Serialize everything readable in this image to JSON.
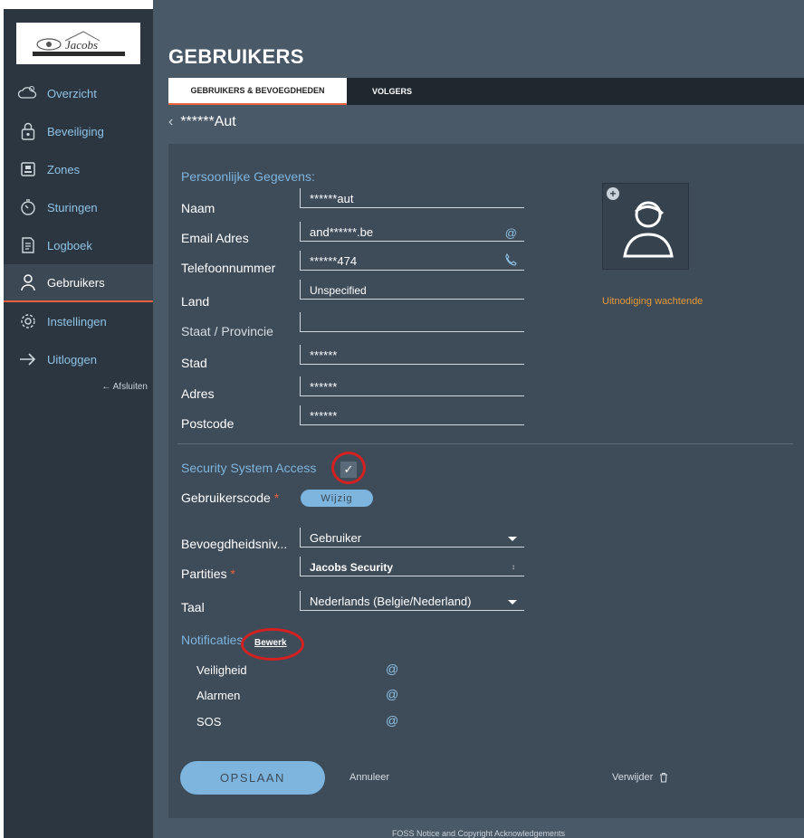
{
  "logo_text": "Jacobs",
  "sidebar": {
    "items": [
      {
        "label": "Overzicht",
        "icon": "weather-icon"
      },
      {
        "label": "Beveiliging",
        "icon": "lock-icon"
      },
      {
        "label": "Zones",
        "icon": "zones-icon"
      },
      {
        "label": "Sturingen",
        "icon": "timer-icon"
      },
      {
        "label": "Logboek",
        "icon": "logbook-icon"
      },
      {
        "label": "Gebruikers",
        "icon": "user-icon",
        "active": true
      },
      {
        "label": "Instellingen",
        "icon": "gear-icon"
      },
      {
        "label": "Uitloggen",
        "icon": "logout-icon"
      }
    ],
    "afsluiten": "← Afsluiten"
  },
  "page": {
    "title": "GEBRUIKERS",
    "tabs": [
      "GEBRUIKERS & BEVOEGDHEDEN",
      "VOLGERS"
    ],
    "active_tab": 0,
    "back_label": "******Aut"
  },
  "personal": {
    "section_title": "Persoonlijke Gegevens:",
    "fields": [
      {
        "label": "Naam",
        "value": "******aut"
      },
      {
        "label": "Email Adres",
        "value": "and******.be",
        "suffix": "@"
      },
      {
        "label": "Telefoonnummer",
        "value": "******474",
        "suffix": "phone"
      },
      {
        "label": "Land",
        "value": "Unspecified"
      },
      {
        "label": "Staat / Provincie",
        "value": ""
      },
      {
        "label": "Stad",
        "value": "******"
      },
      {
        "label": "Adres",
        "value": "******"
      },
      {
        "label": "Postcode",
        "value": "******"
      }
    ],
    "pending_invitation": "Uitnodiging wachtende"
  },
  "access": {
    "section_title": "Security System Access",
    "checked": true,
    "checkmark": "✓",
    "usercode_label": "Gebruikerscode",
    "required_mark": "*",
    "change_button": "Wijzig",
    "level_label": "Bevoegdheidsniv...",
    "level_value": "Gebruiker",
    "partitions_label": "Partities",
    "partitions_value": "Jacobs Security",
    "language_label": "Taal",
    "language_value": "Nederlands (Belgie/Nederland)"
  },
  "notifications": {
    "section_title": "Notificaties",
    "edit_link": "Bewerk",
    "items": [
      {
        "label": "Veiligheid",
        "channel": "@"
      },
      {
        "label": "Alarmen",
        "channel": "@"
      },
      {
        "label": "SOS",
        "channel": "@"
      }
    ]
  },
  "actions": {
    "save": "OPSLAAN",
    "cancel": "Annuleer",
    "delete": "Verwijder"
  },
  "footer": "FOSS Notice and Copyright Acknowledgements",
  "colors": {
    "sidebar_bg": "#2b3640",
    "main_bg": "#4a5968",
    "panel_bg": "#3e4b58",
    "accent_blue": "#7db5df",
    "accent_orange": "#e8613b",
    "pending_orange": "#e79a36",
    "highlight_red": "#d42020"
  }
}
